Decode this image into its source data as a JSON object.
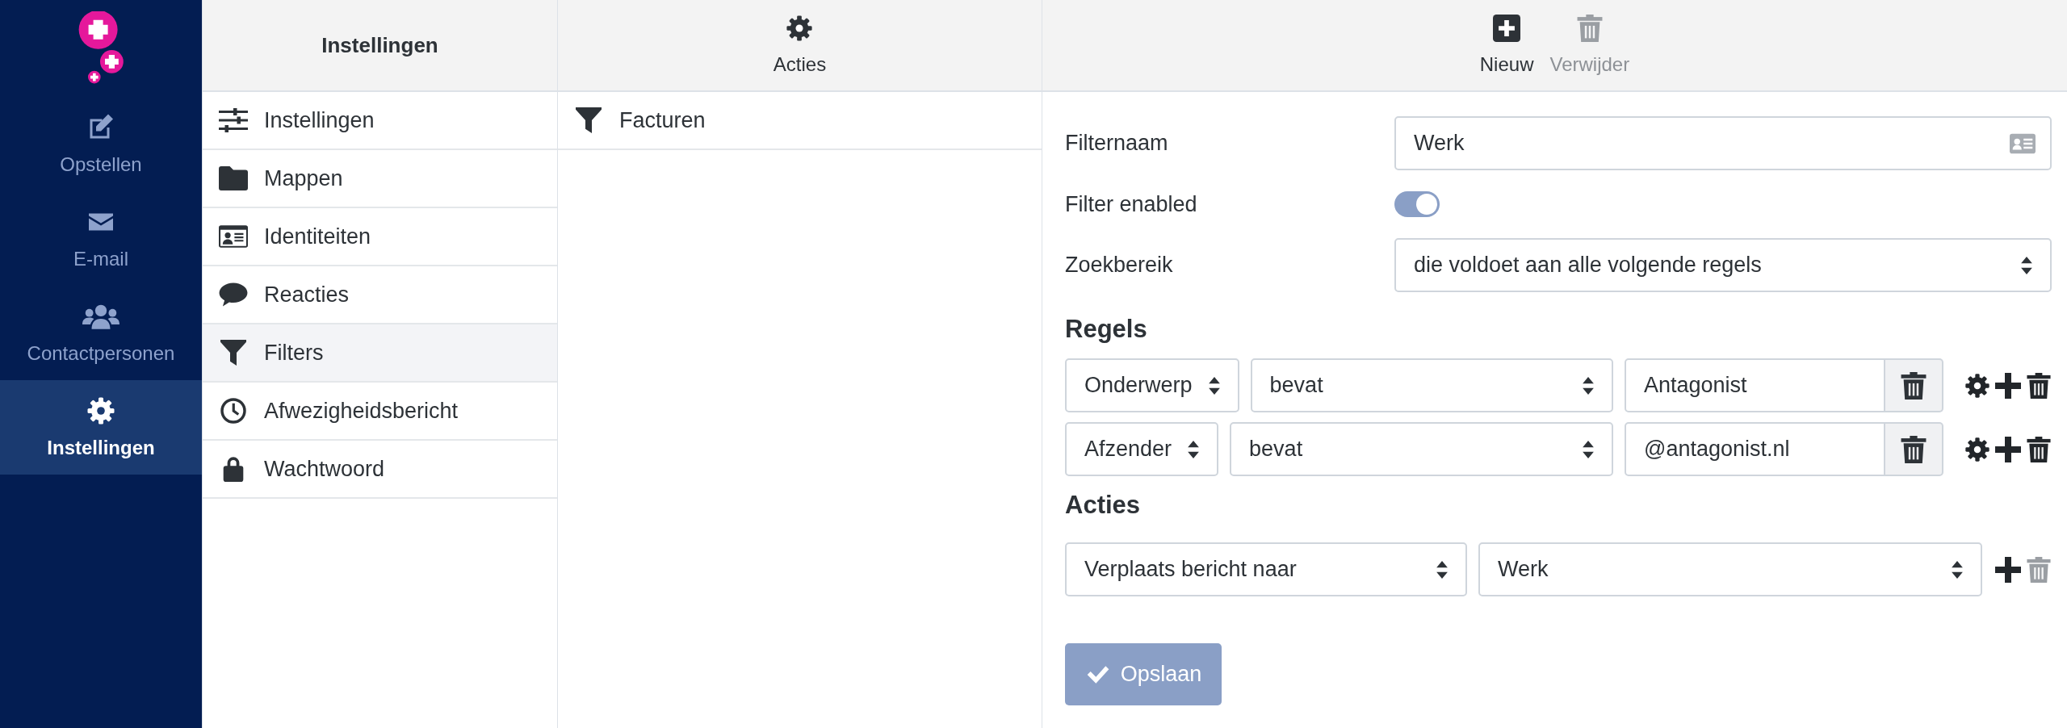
{
  "sidebar": {
    "items": [
      {
        "label": "Opstellen",
        "kind": "compose",
        "selected": false
      },
      {
        "label": "E-mail",
        "kind": "mail",
        "selected": false
      },
      {
        "label": "Contactpersonen",
        "kind": "contacts",
        "selected": false
      },
      {
        "label": "Instellingen",
        "kind": "settings",
        "selected": true
      }
    ]
  },
  "settings_panel": {
    "title": "Instellingen",
    "items": [
      {
        "label": "Instellingen",
        "kind": "sliders",
        "selected": false
      },
      {
        "label": "Mappen",
        "kind": "folder",
        "selected": false
      },
      {
        "label": "Identiteiten",
        "kind": "idcard",
        "selected": false
      },
      {
        "label": "Reacties",
        "kind": "comment",
        "selected": false
      },
      {
        "label": "Filters",
        "kind": "filter",
        "selected": true
      },
      {
        "label": "Afwezigheidsbericht",
        "kind": "clock",
        "selected": false
      },
      {
        "label": "Wachtwoord",
        "kind": "lock",
        "selected": false
      }
    ]
  },
  "filters_panel": {
    "toolbar_button": "Acties",
    "items": [
      {
        "label": "Facturen",
        "selected": false
      }
    ]
  },
  "toolbar": {
    "buttons": [
      {
        "label": "Nieuw",
        "kind": "new",
        "disabled": false
      },
      {
        "label": "Verwijder",
        "kind": "delete",
        "disabled": true
      }
    ]
  },
  "form": {
    "filter_name": {
      "label": "Filternaam",
      "value": "Werk"
    },
    "enabled": {
      "label": "Filter enabled",
      "on": true
    },
    "scope": {
      "label": "Zoekbereik",
      "value": "die voldoet aan alle volgende regels"
    },
    "rules_heading": "Regels",
    "rules": [
      {
        "field": "Onderwerp",
        "operator": "bevat",
        "value": "Antagonist"
      },
      {
        "field": "Afzender",
        "operator": "bevat",
        "value": "@antagonist.nl"
      }
    ],
    "actions_heading": "Acties",
    "actions": [
      {
        "action": "Verplaats bericht naar",
        "target": "Werk",
        "delete_disabled": true
      }
    ],
    "save": {
      "label": "Opslaan",
      "disabled": true
    }
  }
}
